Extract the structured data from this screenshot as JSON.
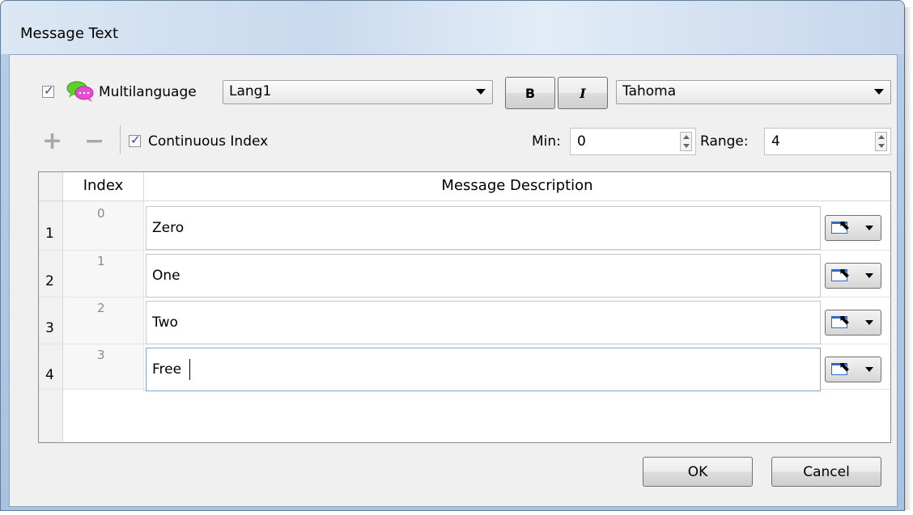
{
  "window": {
    "title": "Message Text"
  },
  "toolbar": {
    "multilanguage_label": "Multilanguage",
    "multilanguage_checked": true,
    "language_value": "Lang1",
    "bold_label": "B",
    "italic_label": "I",
    "font_value": "Tahoma",
    "add_label": "+",
    "remove_label": "−",
    "continuous_index_label": "Continuous Index",
    "continuous_index_checked": true,
    "min_label": "Min:",
    "min_value": "0",
    "range_label": "Range:",
    "range_value": "4"
  },
  "grid": {
    "columns": [
      "Index",
      "Message Description"
    ],
    "rows": [
      {
        "row": "1",
        "index": "0",
        "description": "Zero"
      },
      {
        "row": "2",
        "index": "1",
        "description": "One"
      },
      {
        "row": "3",
        "index": "2",
        "description": "Two"
      },
      {
        "row": "4",
        "index": "3",
        "description": "Free"
      }
    ]
  },
  "buttons": {
    "ok": "OK",
    "cancel": "Cancel"
  },
  "colors": {
    "accent": "#2e6bc9",
    "chat_icon_green": "#5ccf2a",
    "chat_icon_pink": "#e64bd0"
  },
  "icons": {
    "multilanguage": "chat-bubbles-icon",
    "add": "plus-icon",
    "remove": "minus-icon",
    "picker": "field-picker-icon"
  }
}
